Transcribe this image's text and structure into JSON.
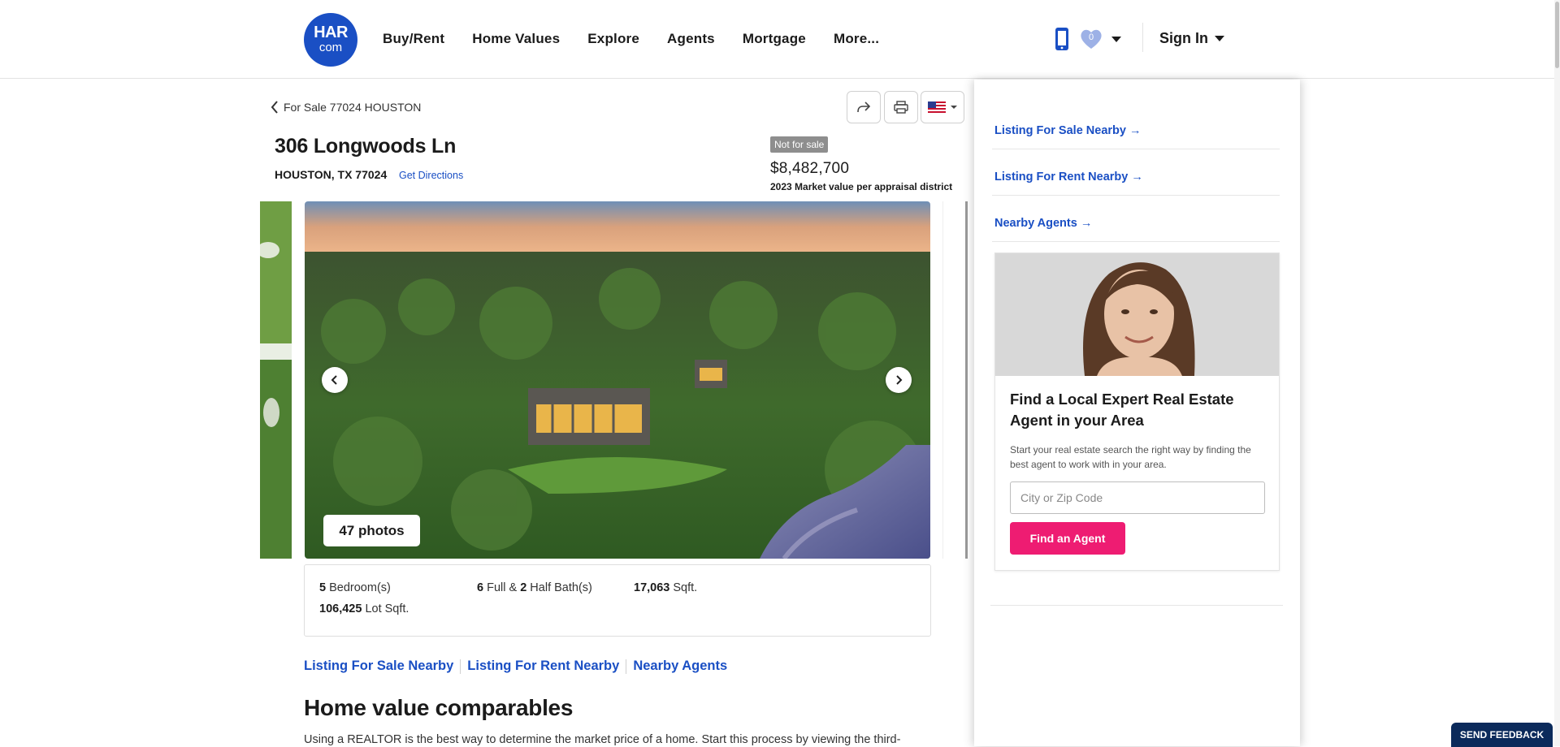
{
  "header": {
    "logo_line1": "HAR",
    "logo_line2": "com",
    "nav": [
      "Buy/Rent",
      "Home Values",
      "Explore",
      "Agents",
      "Mortgage",
      "More..."
    ],
    "favorites_count": "0",
    "signin_label": "Sign In"
  },
  "listing": {
    "back_label": "For Sale 77024 HOUSTON",
    "address_line1": "306 Longwoods Ln",
    "address_line2": "HOUSTON, TX 77024",
    "directions_label": "Get Directions",
    "status_badge": "Not for sale",
    "price": "$8,482,700",
    "price_note": "2023 Market value per appraisal district",
    "photos_label": "47 photos",
    "facts": {
      "bedrooms_num": "5",
      "bedrooms_label": " Bedroom(s)",
      "full_baths": "6",
      "baths_and": " Full & ",
      "half_baths": "2",
      "baths_label": " Half Bath(s)",
      "sqft_num": "17,063",
      "sqft_label": " Sqft.",
      "lot_num": "106,425",
      "lot_label": " Lot Sqft."
    }
  },
  "links_row": [
    "Listing For Sale Nearby",
    "Listing For Rent Nearby",
    "Nearby Agents"
  ],
  "comparables": {
    "title": "Home value comparables",
    "text": "Using a REALTOR is the best way to determine the market price of a home. Start this process by viewing the third-"
  },
  "sidebar": {
    "links": [
      "Listing For Sale Nearby →",
      "Listing For Rent Nearby →",
      "Nearby Agents →"
    ],
    "card_title": "Find a Local Expert Real Estate Agent in your Area",
    "card_desc": "Start your real estate search the right way by finding the best agent to work with in your area.",
    "card_placeholder": "City or Zip Code",
    "card_button": "Find an Agent"
  },
  "feedback_label": "SEND FEEDBACK",
  "colors": {
    "brand_blue": "#1a4fc4",
    "cta_pink": "#ee1c72",
    "feedback_navy": "#0b2a5b"
  }
}
